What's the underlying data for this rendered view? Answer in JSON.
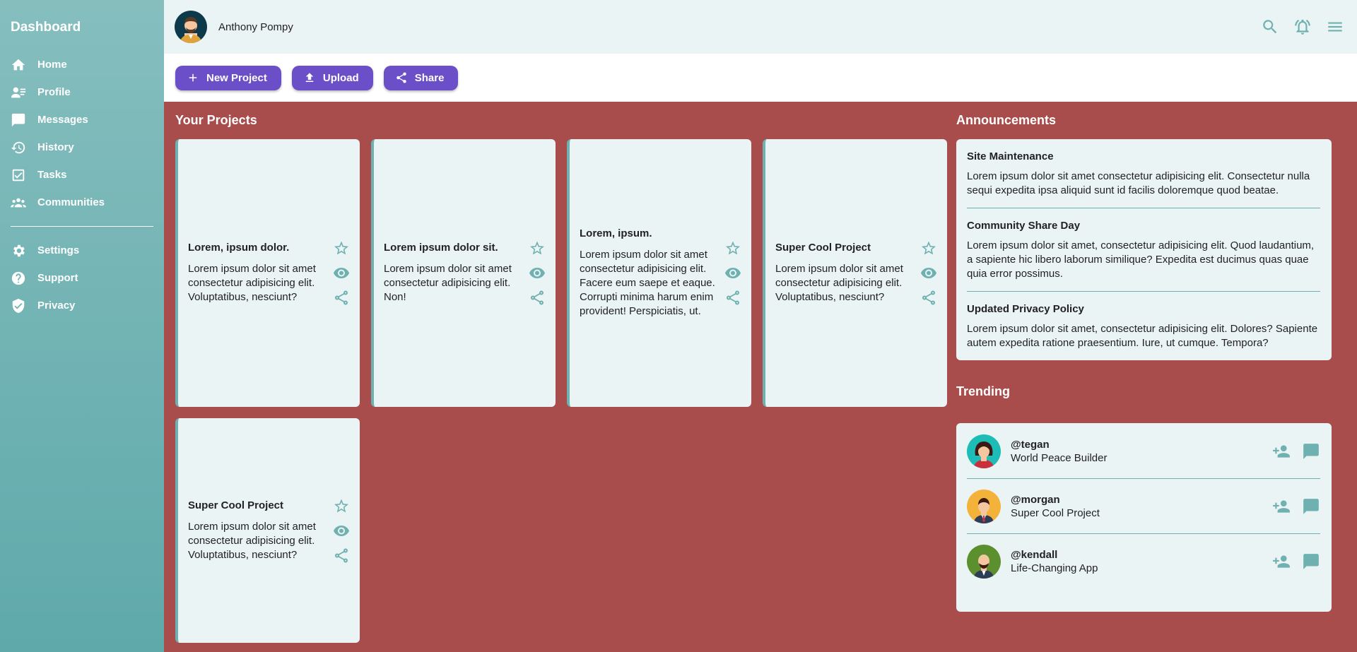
{
  "sidebar": {
    "brand": "Dashboard",
    "items": [
      {
        "label": "Home",
        "icon": "home-icon"
      },
      {
        "label": "Profile",
        "icon": "profile-icon"
      },
      {
        "label": "Messages",
        "icon": "messages-icon"
      },
      {
        "label": "History",
        "icon": "history-icon"
      },
      {
        "label": "Tasks",
        "icon": "tasks-icon"
      },
      {
        "label": "Communities",
        "icon": "communities-icon"
      }
    ],
    "items2": [
      {
        "label": "Settings",
        "icon": "settings-icon"
      },
      {
        "label": "Support",
        "icon": "support-icon"
      },
      {
        "label": "Privacy",
        "icon": "privacy-icon"
      }
    ]
  },
  "header": {
    "username": "Anthony Pompy"
  },
  "toolbar": {
    "new_project": "New Project",
    "upload": "Upload",
    "share": "Share"
  },
  "projects": {
    "title": "Your Projects",
    "cards": [
      {
        "title": "Lorem, ipsum dolor.",
        "text": "Lorem ipsum dolor sit amet consectetur adipisicing elit. Voluptatibus, nesciunt?"
      },
      {
        "title": "Lorem ipsum dolor sit.",
        "text": "Lorem ipsum dolor sit amet consectetur adipisicing elit. Non!"
      },
      {
        "title": "Lorem, ipsum.",
        "text": "Lorem ipsum dolor sit amet consectetur adipisicing elit. Facere eum saepe et eaque. Corrupti minima harum enim provident! Perspiciatis, ut."
      },
      {
        "title": "Super Cool Project",
        "text": "Lorem ipsum dolor sit amet consectetur adipisicing elit. Voluptatibus, nesciunt?"
      },
      {
        "title": "Super Cool Project",
        "text": "Lorem ipsum dolor sit amet consectetur adipisicing elit. Voluptatibus, nesciunt?"
      }
    ]
  },
  "announcements": {
    "title": "Announcements",
    "items": [
      {
        "title": "Site Maintenance",
        "text": "Lorem ipsum dolor sit amet consectetur adipisicing elit. Consectetur nulla sequi expedita ipsa aliquid sunt id facilis doloremque quod beatae."
      },
      {
        "title": "Community Share Day",
        "text": "Lorem ipsum dolor sit amet, consectetur adipisicing elit. Quod laudantium, a sapiente hic libero laborum similique? Expedita est ducimus quas quae quia error possimus."
      },
      {
        "title": "Updated Privacy Policy",
        "text": "Lorem ipsum dolor sit amet, consectetur adipisicing elit. Dolores? Sapiente autem expedita ratione praesentium. Iure, ut cumque. Tempora?"
      }
    ]
  },
  "trending": {
    "title": "Trending",
    "items": [
      {
        "handle": "@tegan",
        "sub": "World Peace Builder",
        "bg": "#1ebcb6"
      },
      {
        "handle": "@morgan",
        "sub": "Super Cool Project",
        "bg": "#f3b23a"
      },
      {
        "handle": "@kendall",
        "sub": "Life-Changing App",
        "bg": "#5c8f2e"
      }
    ]
  },
  "colors": {
    "accent": "#6b4fc8",
    "teal": "#6fb0b0",
    "bg": "#a84c4c"
  }
}
